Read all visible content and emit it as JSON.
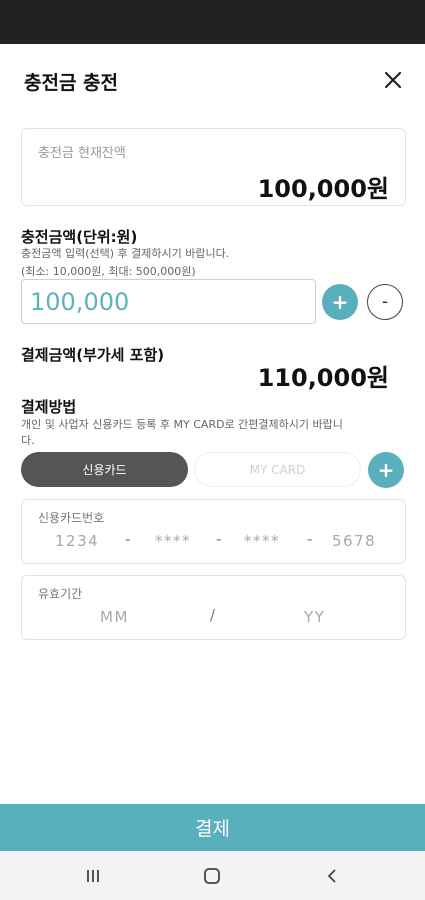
{
  "header": {
    "title": "충전금 충전"
  },
  "balance": {
    "label": "충전금 현재잔액",
    "value": "100,000원"
  },
  "charge": {
    "title": "충전금액(단위:원)",
    "hint1": "충전금액 입력(선택) 후 결제하시기 바랍니다.",
    "hint2": "(최소: 10,000원, 최대: 500,000원)",
    "input_value": "100,000",
    "plus_label": "+",
    "minus_label": "-"
  },
  "payment_amount": {
    "title": "결제금액(부가세 포함)",
    "value": "110,000원"
  },
  "payment_method": {
    "title": "결제방법",
    "hint_line1": "개인 및 사업자 신용카드 등록 후 MY CARD로 간편결제하시기 바랍니",
    "hint_line2": "다.",
    "credit_card_label": "신용카드",
    "my_card_label": "MY CARD",
    "add_label": "+"
  },
  "card_number": {
    "label": "신용카드번호",
    "segments": [
      "1234",
      "****",
      "****",
      "5678"
    ],
    "separator": "-"
  },
  "expiry": {
    "label": "유효기간",
    "month_placeholder": "MM",
    "year_placeholder": "YY",
    "separator": "/"
  },
  "pay_button": {
    "label": "결제"
  },
  "colors": {
    "accent": "#5aafbc",
    "dark": "#555555",
    "status_bar": "#222222"
  },
  "icons": {
    "close": "close-icon",
    "recent": "recent-apps-icon",
    "home": "home-icon",
    "back": "back-icon"
  }
}
